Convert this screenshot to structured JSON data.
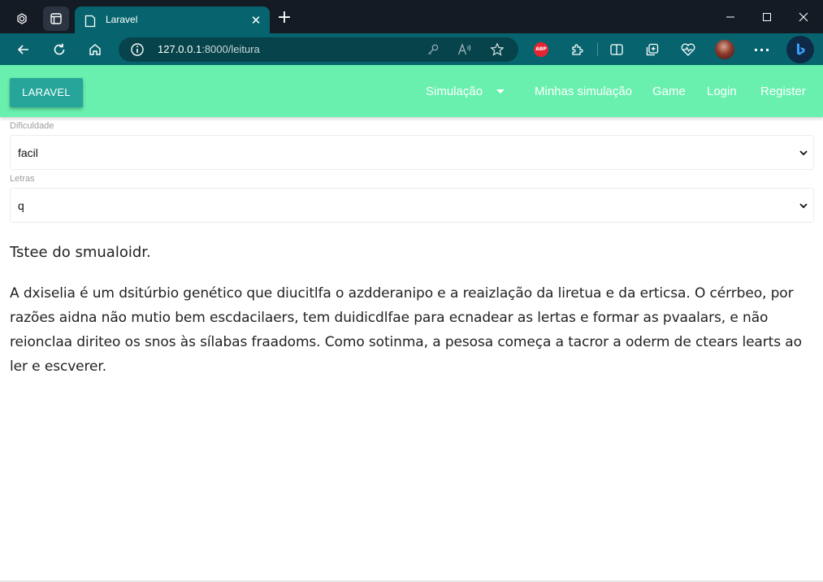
{
  "browser": {
    "tab_title": "Laravel",
    "tab_close": "✕",
    "new_tab": "+",
    "url_host": "127.0.0.1",
    "url_rest": ":8000/leitura",
    "abp_label": "ABP",
    "more_label": "···",
    "icons": [
      "workspaces-icon",
      "tab-actions-icon",
      "laravel-favicon",
      "minimize-icon",
      "maximize-icon",
      "close-window-icon",
      "back-icon",
      "refresh-icon",
      "home-icon",
      "site-info-icon",
      "key-icon",
      "read-aloud-icon",
      "favorite-star-icon",
      "adblock-plus-icon",
      "extensions-icon",
      "split-screen-icon",
      "collections-icon",
      "browser-essentials-icon",
      "profile-avatar",
      "more-icon",
      "bing-copilot-icon"
    ],
    "colors": {
      "titlebar": "#141b24",
      "tab": "#07646e",
      "urlbox": "#06434a"
    }
  },
  "navbar": {
    "brand": "LARAVEL",
    "links": [
      "Simulação",
      "Minhas simulação",
      "Game",
      "Login",
      "Register"
    ],
    "colors": {
      "background": "#69f0ae",
      "brand": "#26a69a"
    }
  },
  "form": {
    "difficulty": {
      "label": "Dificuldade",
      "value": "facil"
    },
    "letters": {
      "label": "Letras",
      "value": "q"
    }
  },
  "content": {
    "heading": "Tstee do smualoidr.",
    "paragraph": "A dxiselia é um dsitúrbio genético que diucitlfa o azdderanipo e a reaizlação da liretua e da erticsa. O cérrbeo, por razões aidna não mutio bem escdacilaers, tem duidicdlfae para ecnadear as lertas e formar as pvaalars, e não reionclaa diriteo os snos às sílabas fraadoms. Como sotinma, a pesosa começa a tacror a oderm de ctears learts ao ler e escverer."
  }
}
